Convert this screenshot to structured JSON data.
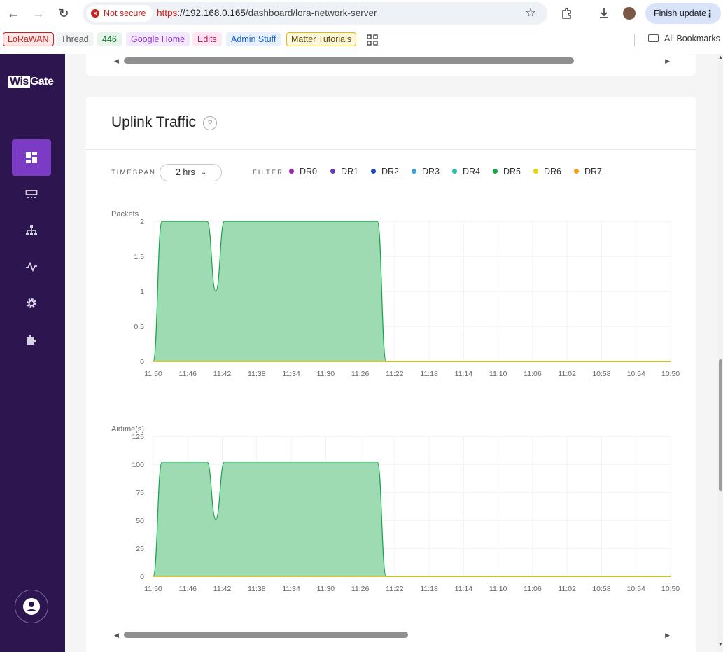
{
  "browser": {
    "not_secure": "Not secure",
    "url_scheme": "https",
    "url_host": "://192.168.0.165",
    "url_path": "/dashboard/lora-network-server",
    "finish_update": "Finish update"
  },
  "bookmarks": {
    "items": [
      {
        "label": "LoRaWAN",
        "color": "#c5221f",
        "bg": "#fce8e6",
        "border": "#c5221f"
      },
      {
        "label": "Thread",
        "color": "#555555",
        "bg": "#f1f3f4",
        "border": "#f1f3f4"
      },
      {
        "label": "446",
        "color": "#137333",
        "bg": "#e6f4ea",
        "border": "#e6f4ea"
      },
      {
        "label": "Google Home",
        "color": "#8430ce",
        "bg": "#f3e8fd",
        "border": "#f3e8fd"
      },
      {
        "label": "Edits",
        "color": "#c2185b",
        "bg": "#fde7f3",
        "border": "#fde7f3"
      },
      {
        "label": "Admin Stuff",
        "color": "#1967d2",
        "bg": "#e8f0fe",
        "border": "#e8f0fe"
      },
      {
        "label": "Matter Tutorials",
        "color": "#5f4b00",
        "bg": "#fef7e0",
        "border": "#e8b600"
      }
    ],
    "all_bookmarks": "All Bookmarks"
  },
  "sidebar": {
    "logo_wis": "Wis",
    "logo_gate": "Gate",
    "items": [
      {
        "name": "dashboard",
        "active": true
      },
      {
        "name": "gateway"
      },
      {
        "name": "network"
      },
      {
        "name": "activity"
      },
      {
        "name": "settings"
      },
      {
        "name": "extensions"
      }
    ]
  },
  "card": {
    "title": "Uplink Traffic",
    "help": "?",
    "timespan_label": "TIMESPAN",
    "timespan_value": "2 hrs",
    "filter_label": "FILTER",
    "filters": [
      {
        "label": "DR0",
        "color": "#9c27b0"
      },
      {
        "label": "DR1",
        "color": "#673ab7"
      },
      {
        "label": "DR2",
        "color": "#1e48b8"
      },
      {
        "label": "DR3",
        "color": "#3aa0e0"
      },
      {
        "label": "DR4",
        "color": "#26bfa9"
      },
      {
        "label": "DR5",
        "color": "#14a84a"
      },
      {
        "label": "DR6",
        "color": "#e6d600"
      },
      {
        "label": "DR7",
        "color": "#f39c12"
      }
    ]
  },
  "chart_data": [
    {
      "type": "area",
      "title": "",
      "ylabel": "Packets",
      "x_ticks": [
        "11:50",
        "11:46",
        "11:42",
        "11:38",
        "11:34",
        "11:30",
        "11:26",
        "11:22",
        "11:18",
        "11:14",
        "11:10",
        "11:06",
        "11:02",
        "10:58",
        "10:54",
        "10:50"
      ],
      "ylim": [
        0,
        2
      ],
      "y_ticks": [
        0,
        0.5,
        1,
        1.5,
        2
      ],
      "y_tick_labels": [
        "0",
        "0.5",
        "1",
        "1.5",
        "2"
      ],
      "x_minutes_ago": [
        0,
        2,
        12.5,
        14.5,
        16.5,
        52,
        54,
        120
      ],
      "values": [
        0,
        2,
        2,
        1,
        2,
        2,
        0,
        0
      ],
      "series": [
        {
          "color": "#14a84a",
          "fill": "#9fdbb2"
        }
      ]
    },
    {
      "type": "area",
      "title": "",
      "ylabel": "Airtime(s)",
      "x_ticks": [
        "11:50",
        "11:46",
        "11:42",
        "11:38",
        "11:34",
        "11:30",
        "11:26",
        "11:22",
        "11:18",
        "11:14",
        "11:10",
        "11:06",
        "11:02",
        "10:58",
        "10:54",
        "10:50"
      ],
      "ylim": [
        0,
        125
      ],
      "y_ticks": [
        0,
        25,
        50,
        75,
        100,
        125
      ],
      "y_tick_labels": [
        "0",
        "25",
        "50",
        "75",
        "100",
        "125"
      ],
      "x_minutes_ago": [
        0,
        2,
        12.5,
        14.5,
        16.5,
        52,
        54,
        120
      ],
      "values": [
        0,
        102,
        102,
        51,
        102,
        102,
        0,
        0
      ],
      "series": [
        {
          "color": "#14a84a",
          "fill": "#9fdbb2"
        }
      ]
    }
  ]
}
